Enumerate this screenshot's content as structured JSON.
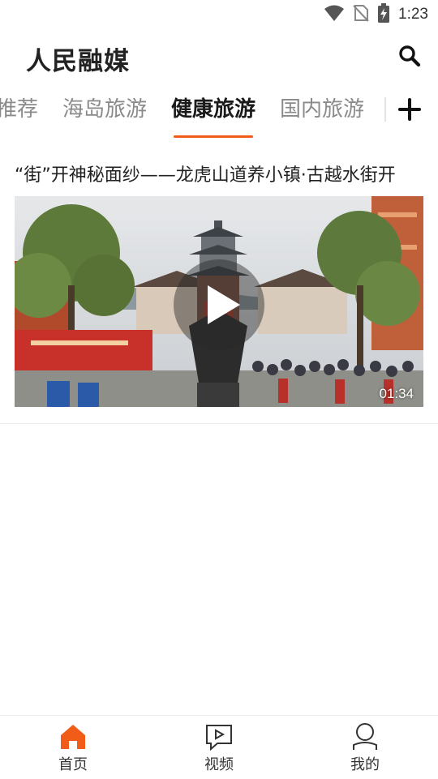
{
  "status_bar": {
    "time": "1:23"
  },
  "header": {
    "title": "人民融媒",
    "search_icon": "search-icon"
  },
  "tabs": [
    {
      "label": "推荐",
      "active": false
    },
    {
      "label": "海岛旅游",
      "active": false
    },
    {
      "label": "健康旅游",
      "active": true
    },
    {
      "label": "国内旅游",
      "active": false
    }
  ],
  "tab_add_icon": "plus-icon",
  "article": {
    "title": "“街”开神秘面纱——龙虎山道养小镇·古越水街开",
    "duration": "01:34"
  },
  "bottom_nav": [
    {
      "label": "首页",
      "icon": "home-icon",
      "active": true
    },
    {
      "label": "视频",
      "icon": "video-icon",
      "active": false
    },
    {
      "label": "我的",
      "icon": "profile-icon",
      "active": false
    }
  ],
  "colors": {
    "accent": "#f25c19",
    "text": "#222222",
    "tab_inactive": "#8a8a8a"
  }
}
